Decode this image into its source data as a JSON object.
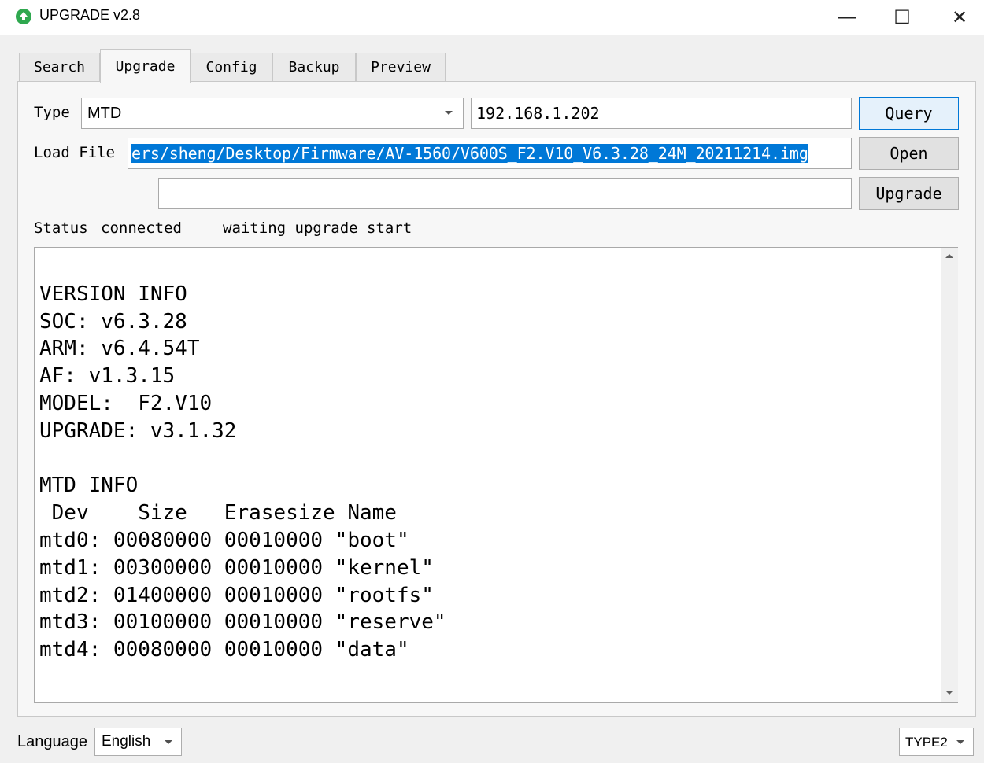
{
  "window": {
    "title": "UPGRADE v2.8",
    "minimize_glyph": "—",
    "maximize_glyph": "☐",
    "close_glyph": "✕"
  },
  "tabs": [
    {
      "label": "Search"
    },
    {
      "label": "Upgrade",
      "active": true
    },
    {
      "label": "Config"
    },
    {
      "label": "Backup"
    },
    {
      "label": "Preview"
    }
  ],
  "upgrade": {
    "type_label": "Type",
    "type_value": "MTD",
    "ip_value": "192.168.1.202",
    "query_button": "Query",
    "load_file_label": "Load File",
    "load_file_value": "ers/sheng/Desktop/Firmware/AV-1560/V600S_F2.V10_V6.3.28_24M_20211214.img",
    "open_button": "Open",
    "extra_field_value": "",
    "upgrade_button": "Upgrade",
    "status_label": "Status",
    "status_value": "connected",
    "status_message": "waiting upgrade start",
    "output_lines": [
      "VERSION INFO",
      "SOC: v6.3.28",
      "ARM: v6.4.54T",
      "AF: v1.3.15",
      "MODEL:  F2.V10",
      "UPGRADE: v3.1.32",
      "",
      "MTD INFO",
      " Dev    Size   Erasesize Name",
      "mtd0: 00080000 00010000 \"boot\"",
      "mtd1: 00300000 00010000 \"kernel\"",
      "mtd2: 01400000 00010000 \"rootfs\"",
      "mtd3: 00100000 00010000 \"reserve\"",
      "mtd4: 00080000 00010000 \"data\""
    ]
  },
  "footer": {
    "language_label": "Language",
    "language_value": "English",
    "type_select_value": "TYPE2"
  },
  "colors": {
    "accent": "#0078d7",
    "app_icon": "#2fa84f"
  },
  "icons": {
    "app": "app-icon",
    "dropdown": "chevron-down-icon",
    "scroll_up": "scroll-up-icon",
    "scroll_down": "scroll-down-icon"
  }
}
